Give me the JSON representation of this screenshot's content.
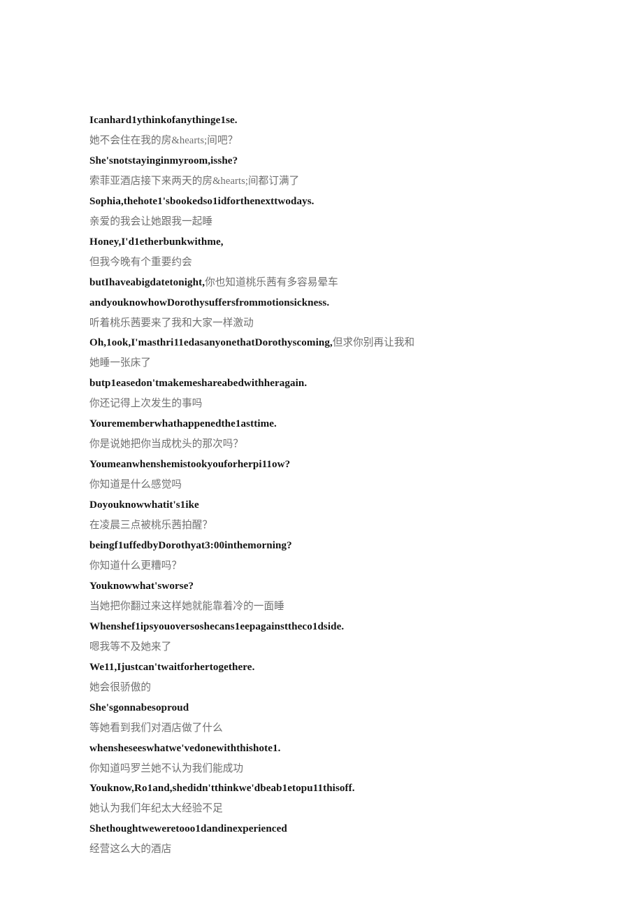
{
  "page": {
    "background_color": "#ffffff",
    "zh_text_color": "#6f6f6f",
    "en_text_color": "#141414"
  },
  "transcript": {
    "lines": [
      {
        "lang": "en",
        "text": "Icanhard1ythinkofanythinge1se."
      },
      {
        "lang": "zh",
        "text": "她不会住在我的房&hearts;间吧？"
      },
      {
        "lang": "en",
        "text": "She'snotstayinginmyroom,isshe?"
      },
      {
        "lang": "zh",
        "text": "索菲亚酒店接下来两天的房&hearts;间都订满了"
      },
      {
        "lang": "en",
        "text": "Sophia,thehote1'sbookedso1idforthenexttwodays."
      },
      {
        "lang": "zh",
        "text": "亲爱的我会让她跟我一起睡"
      },
      {
        "lang": "en",
        "text": "Honey,I'd1etherbunkwithme,"
      },
      {
        "lang": "zh",
        "text": "但我今晚有个重要约会"
      },
      {
        "lang": "mixed",
        "en_part": "butIhaveabigdatetonight,",
        "zh_part": "你也知道桃乐茜有多容易晕车"
      },
      {
        "lang": "en",
        "text": "andyouknowhowDorothysuffersfrommotionsickness."
      },
      {
        "lang": "zh",
        "text": "听着桃乐茜要来了我和大家一样激动"
      },
      {
        "lang": "mixed",
        "en_part": "Oh,1ook,I'masthri11edasanyonethatDorothyscoming,",
        "zh_part": "但求你别再让我和她睡一张床了"
      },
      {
        "lang": "en",
        "text": "butp1easedon'tmakemeshareabedwithheragain."
      },
      {
        "lang": "zh",
        "text": "你还记得上次发生的事吗"
      },
      {
        "lang": "en",
        "text": "Yourememberwhathappenedthe1asttime."
      },
      {
        "lang": "zh",
        "text": "你是说她把你当成枕头的那次吗？"
      },
      {
        "lang": "en",
        "text": "Youmeanwhenshemistookyouforherpi11ow?"
      },
      {
        "lang": "zh",
        "text": "你知道是什么感觉吗"
      },
      {
        "lang": "en",
        "text": "Doyouknowwhatit's1ike"
      },
      {
        "lang": "zh",
        "text": "在凌晨三点被桃乐茜拍醒？"
      },
      {
        "lang": "en",
        "text": "beingf1uffedbyDorothyat3:00inthemorning?"
      },
      {
        "lang": "zh",
        "text": "你知道什么更糟吗？"
      },
      {
        "lang": "en",
        "text": "Youknowwhat'sworse?"
      },
      {
        "lang": "zh",
        "text": "当她把你翻过来这样她就能靠着冷的一面睡"
      },
      {
        "lang": "en",
        "text": "Whenshef1ipsyouoversoshecans1eepagainsttheco1dside."
      },
      {
        "lang": "zh",
        "text": "嗯我等不及她来了"
      },
      {
        "lang": "en",
        "text": "We11,Ijustcan'twaitforhertogethere."
      },
      {
        "lang": "zh",
        "text": "她会很骄傲的"
      },
      {
        "lang": "en",
        "text": "She'sgonnabesoproud"
      },
      {
        "lang": "zh",
        "text": "等她看到我们对酒店做了什么"
      },
      {
        "lang": "en",
        "text": "whensheseeswhatwe'vedonewiththishote1."
      },
      {
        "lang": "zh",
        "text": "你知道吗罗兰她不认为我们能成功"
      },
      {
        "lang": "en",
        "text": "Youknow,Ro1and,shedidn'tthinkwe'dbeab1etopu11thisoff."
      },
      {
        "lang": "zh",
        "text": "她认为我们年纪太大经验不足"
      },
      {
        "lang": "en",
        "text": "Shethoughtweweretooo1dandinexperienced"
      },
      {
        "lang": "zh",
        "text": "经营这么大的酒店"
      }
    ]
  }
}
